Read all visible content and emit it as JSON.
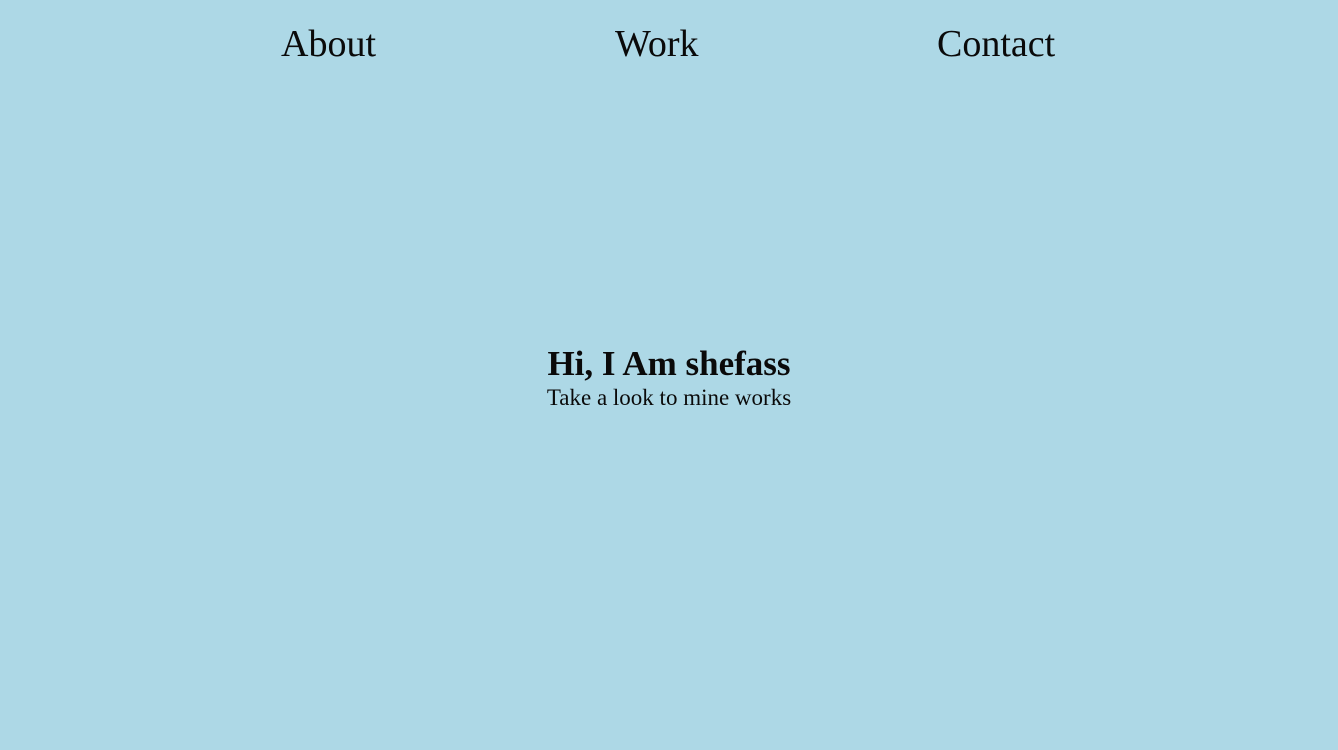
{
  "nav": {
    "items": [
      {
        "label": "About"
      },
      {
        "label": "Work"
      },
      {
        "label": "Contact"
      }
    ]
  },
  "hero": {
    "title": "Hi, I Am shefass",
    "subtitle": "Take a look to mine works"
  },
  "colors": {
    "background": "#add8e6",
    "text": "#0a0a0a"
  }
}
